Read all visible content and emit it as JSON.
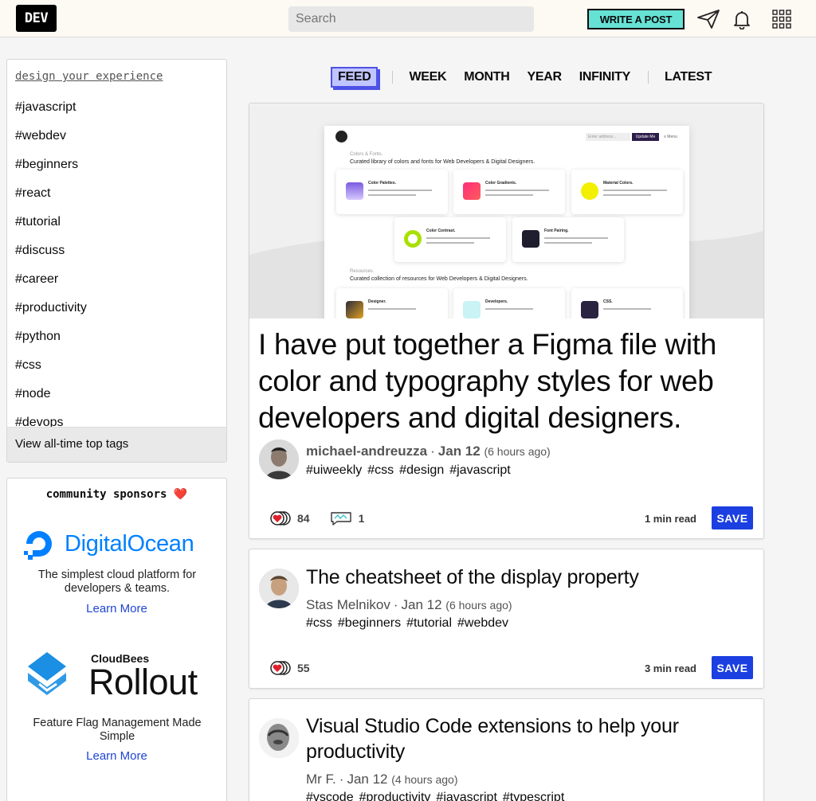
{
  "header": {
    "logo": "DEV",
    "search_placeholder": "Search",
    "write_button": "WRITE A POST"
  },
  "sidebar": {
    "design_link": "design your experience",
    "tags": [
      "#javascript",
      "#webdev",
      "#beginners",
      "#react",
      "#tutorial",
      "#discuss",
      "#career",
      "#productivity",
      "#python",
      "#css",
      "#node",
      "#devops"
    ],
    "footer_link": "View all-time top tags"
  },
  "sponsors": {
    "title": "community sponsors",
    "heart": "❤️",
    "items": [
      {
        "brand": "DigitalOcean",
        "desc": "The simplest cloud platform for developers & teams.",
        "link": "Learn More"
      },
      {
        "brand_top": "CloudBees",
        "brand": "Rollout",
        "desc": "Feature Flag Management Made Simple",
        "link": "Learn More"
      }
    ]
  },
  "tabs": [
    "FEED",
    "WEEK",
    "MONTH",
    "YEAR",
    "INFINITY",
    "LATEST"
  ],
  "cover": {
    "heading1_small": "Colors & Fonts.",
    "heading1": "Curated library of colors and fonts for Web Developers & Digital Designers.",
    "heading2_small": "Resources.",
    "heading2": "Curated collection of resources for Web Developers & Digital Designers.",
    "input_placeholder": "Enter address...",
    "update_btn": "Update Me",
    "menu": "≡ Menu",
    "tiles": [
      "Color Palettes.",
      "Color Gradients.",
      "Material Colors.",
      "Color Contrast.",
      "Font Pairing.",
      "Designer.",
      "Developers.",
      "CSS."
    ]
  },
  "articles": [
    {
      "title": "I have put together a Figma file with color and typography styles for web developers and digital designers.",
      "author": "michael-andreuzza",
      "date": "Jan 12",
      "ago": "(6 hours ago)",
      "tags": [
        "#uiweekly",
        "#css",
        "#design",
        "#javascript"
      ],
      "reactions": "84",
      "comments": "1",
      "read_time": "1 min read",
      "save": "SAVE"
    },
    {
      "title": "The cheatsheet of the display property",
      "author": "Stas Melnikov",
      "date": "Jan 12",
      "ago": "(6 hours ago)",
      "tags": [
        "#css",
        "#beginners",
        "#tutorial",
        "#webdev"
      ],
      "reactions": "55",
      "read_time": "3 min read",
      "save": "SAVE"
    },
    {
      "title": "Visual Studio Code extensions to help your productivity",
      "author": "Mr F.",
      "date": "Jan 12",
      "ago": "(4 hours ago)",
      "tags": [
        "#vscode",
        "#productivity",
        "#javascript",
        "#typescript"
      ]
    }
  ],
  "colors": {
    "accent": "#66e2d5",
    "save": "#1b3fe0",
    "feed_tab": "#c1c5ff",
    "link": "#1f45d6"
  }
}
